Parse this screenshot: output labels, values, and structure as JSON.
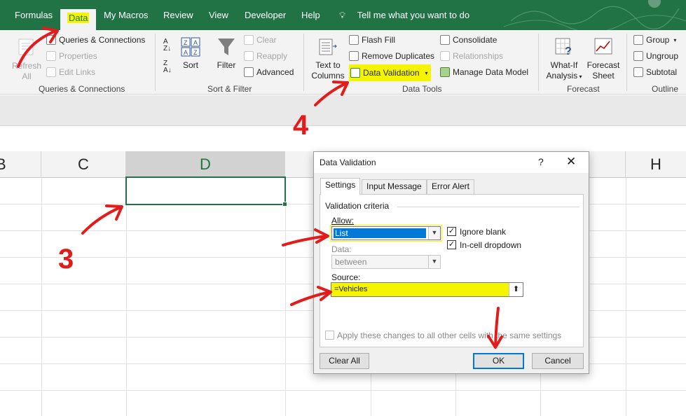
{
  "ribbon_tabs": [
    "Formulas",
    "Data",
    "My Macros",
    "Review",
    "View",
    "Developer",
    "Help"
  ],
  "tell_me": "Tell me what you want to do",
  "queries_group": {
    "refresh_all": "Refresh All",
    "queries_connections": "Queries & Connections",
    "properties": "Properties",
    "edit_links": "Edit Links",
    "label": "Queries & Connections"
  },
  "sort_filter_group": {
    "sort": "Sort",
    "filter": "Filter",
    "clear": "Clear",
    "reapply": "Reapply",
    "advanced": "Advanced",
    "label": "Sort & Filter"
  },
  "data_tools_group": {
    "text_to_columns_line1": "Text to",
    "text_to_columns_line2": "Columns",
    "flash_fill": "Flash Fill",
    "remove_duplicates": "Remove Duplicates",
    "data_validation": "Data Validation",
    "consolidate": "Consolidate",
    "relationships": "Relationships",
    "manage_data_model": "Manage Data Model",
    "label": "Data Tools"
  },
  "forecast_group": {
    "what_if_line1": "What-If",
    "what_if_line2": "Analysis",
    "forecast_sheet_line1": "Forecast",
    "forecast_sheet_line2": "Sheet",
    "label": "Forecast"
  },
  "outline_group": {
    "group": "Group",
    "ungroup": "Ungroup",
    "subtotal": "Subtotal",
    "label": "Outline"
  },
  "columns": [
    "B",
    "C",
    "D",
    "H"
  ],
  "dialog": {
    "title": "Data Validation",
    "help": "?",
    "close": "✕",
    "tabs": [
      "Settings",
      "Input Message",
      "Error Alert"
    ],
    "section": "Validation criteria",
    "allow_label": "Allow:",
    "allow_value": "List",
    "data_label": "Data:",
    "data_value": "between",
    "ignore_blank": "Ignore blank",
    "in_cell_dropdown": "In-cell dropdown",
    "source_label": "Source:",
    "source_value": "=Vehicles",
    "apply_all": "Apply these changes to all other cells with the same settings",
    "clear_all": "Clear All",
    "ok": "OK",
    "cancel": "Cancel"
  },
  "annotations": [
    "3",
    "4"
  ],
  "colors": {
    "excel_green": "#217346",
    "highlight": "#f5f500",
    "annotation_red": "#e21b1b",
    "accent_blue": "#0078d7"
  }
}
